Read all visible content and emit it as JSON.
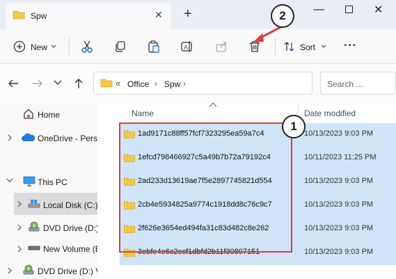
{
  "window": {
    "tab_title": "Spw",
    "close_tab_glyph": "✕",
    "new_tab_glyph": "+",
    "minimize_glyph": "—",
    "close_glyph": "✕"
  },
  "toolbar": {
    "new_label": "New",
    "sort_label": "Sort",
    "more_glyph": "···",
    "icons": [
      "cut-icon",
      "copy-icon",
      "paste-icon",
      "rename-icon",
      "share-icon",
      "delete-icon",
      "sort-icon"
    ]
  },
  "address": {
    "prefix": "«",
    "crumbs": [
      "Office",
      "Spw"
    ],
    "separator": "›",
    "search_placeholder": "Search ..."
  },
  "nav": {
    "items": [
      {
        "label": "Home"
      },
      {
        "label": "OneDrive - Perso"
      },
      {
        "label": "This PC"
      },
      {
        "label": "Local Disk (C:)"
      },
      {
        "label": "DVD Drive (D:)"
      },
      {
        "label": "New Volume (E"
      },
      {
        "label": "DVD Drive (D:) V"
      }
    ]
  },
  "columns": {
    "name": "Name",
    "date_modified": "Date modified"
  },
  "files": [
    {
      "name": "1ad9171c88ff57fcf7323295ea59a7c4",
      "date": "10/13/2023 9:03 PM"
    },
    {
      "name": "1efcd798466927c5a49b7b72a79192c4",
      "date": "10/11/2023 11:25 PM"
    },
    {
      "name": "2ad233d13619ae7f5e2897745821d554",
      "date": "10/13/2023 9:03 PM"
    },
    {
      "name": "2cb4e5934825a9774c1918dd8c76c9c7",
      "date": "10/13/2023 9:03 PM"
    },
    {
      "name": "2f626e3654ed494fa31c83d482c8e262",
      "date": "10/13/2023 9:03 PM"
    },
    {
      "name": "3ebfe4e6c2ecf1dbfd2b11f30807151",
      "date": "10/13/2023 9:03 PM"
    }
  ],
  "annotations": {
    "badge_1": "1",
    "badge_2": "2"
  },
  "colors": {
    "selection": "#cfe4f7",
    "annotation_red": "#e23b3b",
    "folder_yellow": "#f6c84a"
  }
}
